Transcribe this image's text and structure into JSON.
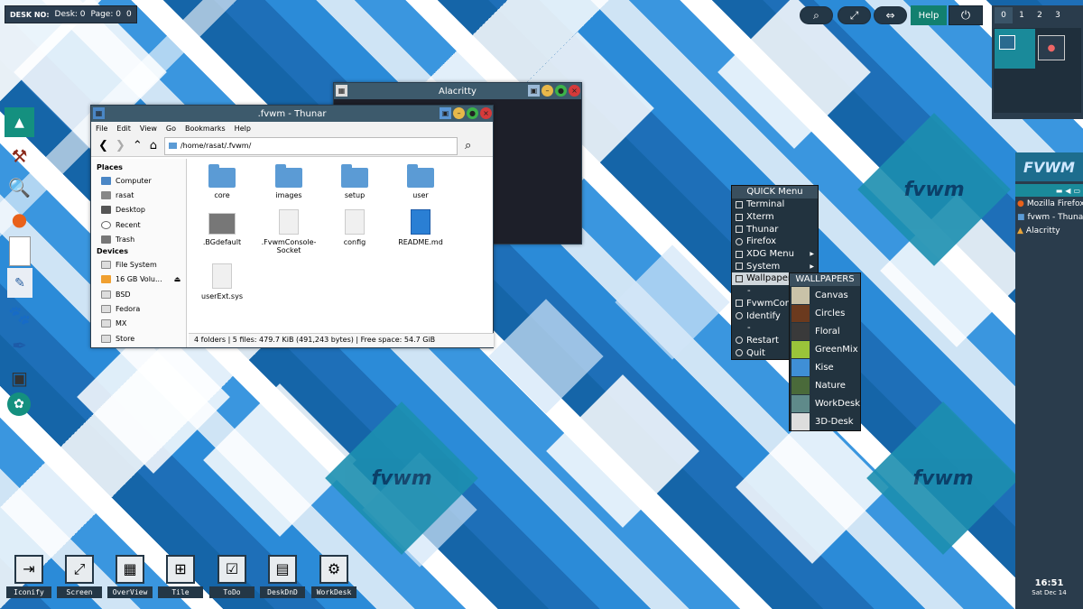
{
  "desk_indicator": {
    "label": "DESK NO:",
    "desk": "Desk: 0",
    "page": "Page: 0",
    "page_y": "0"
  },
  "top_icons": {
    "search": "⌕",
    "resize": "⤢",
    "move": "⇔",
    "help_label": "Help",
    "power": "⏻"
  },
  "pager": {
    "tabs": [
      "0",
      "1",
      "2",
      "3"
    ]
  },
  "dock_icons": [
    "up-arrow-icon",
    "system-tools-icon",
    "magnifier-icon",
    "firefox-icon",
    "document-icon",
    "text-editor-icon",
    "gimp-icon",
    "pen-icon",
    "drive-icon",
    "settings-icon"
  ],
  "thunar": {
    "title": ".fvwm - Thunar",
    "menu": [
      "File",
      "Edit",
      "View",
      "Go",
      "Bookmarks",
      "Help"
    ],
    "path": "/home/rasat/.fvwm/",
    "places_header": "Places",
    "places": [
      "Computer",
      "rasat",
      "Desktop",
      "Recent",
      "Trash"
    ],
    "devices_header": "Devices",
    "devices": [
      "File System",
      "16 GB Volu...",
      "BSD",
      "Fedora",
      "MX",
      "Store"
    ],
    "files": [
      {
        "name": "core",
        "type": "folder"
      },
      {
        "name": "images",
        "type": "folder"
      },
      {
        "name": "setup",
        "type": "folder"
      },
      {
        "name": "user",
        "type": "folder"
      },
      {
        "name": ".BGdefault",
        "type": "image"
      },
      {
        "name": ".FvwmConsole-Socket",
        "type": "file"
      },
      {
        "name": "config",
        "type": "file"
      },
      {
        "name": "README.md",
        "type": "doc"
      },
      {
        "name": "userExt.sys",
        "type": "file"
      }
    ],
    "status": "4 folders  |  5 files: 479.7 KiB (491,243 bytes)  |  Free space: 54.7 GiB"
  },
  "alacritty": {
    "title": "Alacritty"
  },
  "quick_menu": {
    "title": "QUICK Menu",
    "items": [
      "Terminal",
      "Xterm",
      "Thunar",
      "Firefox",
      "XDG Menu",
      "System",
      "Wallpapers",
      "-",
      "FvwmConsole",
      "Identify",
      "-",
      "Restart",
      "Quit"
    ]
  },
  "wallpapers": {
    "title": "WALLPAPERS",
    "items": [
      {
        "name": "Canvas",
        "color": "#c9c2a8"
      },
      {
        "name": "Circles",
        "color": "#6b3a1e"
      },
      {
        "name": "Floral",
        "color": "#3a3a3a"
      },
      {
        "name": "GreenMix",
        "color": "#9ac43a"
      },
      {
        "name": "Kise",
        "color": "#3f8fd6"
      },
      {
        "name": "Nature",
        "color": "#4a6a3a"
      },
      {
        "name": "WorkDesk",
        "color": "#5f8a8a"
      },
      {
        "name": "3D-Desk",
        "color": "#dddddd"
      }
    ]
  },
  "right_panel": {
    "logo": "FVWM",
    "tasks": [
      "Mozilla Firefox",
      "fvwm - Thunar",
      "Alacritty"
    ],
    "time": "16:51",
    "date": "Sat Dec 14"
  },
  "bottom_buttons": [
    {
      "label": "Iconify",
      "icon": "⇥"
    },
    {
      "label": "Screen",
      "icon": "⤢"
    },
    {
      "label": "OverView",
      "icon": "▦"
    },
    {
      "label": "Tile",
      "icon": "⊞"
    },
    {
      "label": "ToDo",
      "icon": "☑"
    },
    {
      "label": "DeskDnD",
      "icon": "▤"
    },
    {
      "label": "WorkDesk",
      "icon": "⚙"
    }
  ],
  "colors": {
    "panel": "#2a3c4c",
    "accent": "#12806f",
    "titlebar": "#3d5a6c"
  }
}
